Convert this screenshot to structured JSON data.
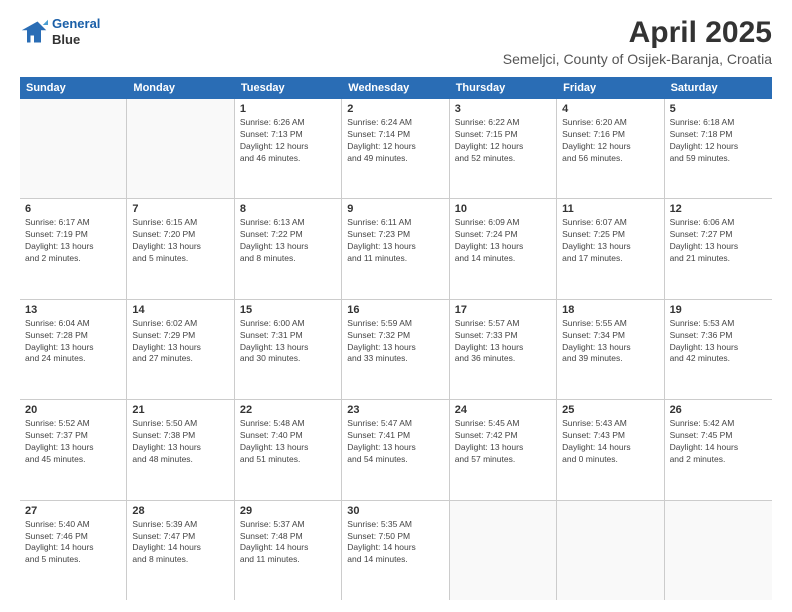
{
  "header": {
    "logo_line1": "General",
    "logo_line2": "Blue",
    "month": "April 2025",
    "location": "Semeljci, County of Osijek-Baranja, Croatia"
  },
  "weekdays": [
    "Sunday",
    "Monday",
    "Tuesday",
    "Wednesday",
    "Thursday",
    "Friday",
    "Saturday"
  ],
  "rows": [
    [
      {
        "day": "",
        "info": ""
      },
      {
        "day": "",
        "info": ""
      },
      {
        "day": "1",
        "info": "Sunrise: 6:26 AM\nSunset: 7:13 PM\nDaylight: 12 hours\nand 46 minutes."
      },
      {
        "day": "2",
        "info": "Sunrise: 6:24 AM\nSunset: 7:14 PM\nDaylight: 12 hours\nand 49 minutes."
      },
      {
        "day": "3",
        "info": "Sunrise: 6:22 AM\nSunset: 7:15 PM\nDaylight: 12 hours\nand 52 minutes."
      },
      {
        "day": "4",
        "info": "Sunrise: 6:20 AM\nSunset: 7:16 PM\nDaylight: 12 hours\nand 56 minutes."
      },
      {
        "day": "5",
        "info": "Sunrise: 6:18 AM\nSunset: 7:18 PM\nDaylight: 12 hours\nand 59 minutes."
      }
    ],
    [
      {
        "day": "6",
        "info": "Sunrise: 6:17 AM\nSunset: 7:19 PM\nDaylight: 13 hours\nand 2 minutes."
      },
      {
        "day": "7",
        "info": "Sunrise: 6:15 AM\nSunset: 7:20 PM\nDaylight: 13 hours\nand 5 minutes."
      },
      {
        "day": "8",
        "info": "Sunrise: 6:13 AM\nSunset: 7:22 PM\nDaylight: 13 hours\nand 8 minutes."
      },
      {
        "day": "9",
        "info": "Sunrise: 6:11 AM\nSunset: 7:23 PM\nDaylight: 13 hours\nand 11 minutes."
      },
      {
        "day": "10",
        "info": "Sunrise: 6:09 AM\nSunset: 7:24 PM\nDaylight: 13 hours\nand 14 minutes."
      },
      {
        "day": "11",
        "info": "Sunrise: 6:07 AM\nSunset: 7:25 PM\nDaylight: 13 hours\nand 17 minutes."
      },
      {
        "day": "12",
        "info": "Sunrise: 6:06 AM\nSunset: 7:27 PM\nDaylight: 13 hours\nand 21 minutes."
      }
    ],
    [
      {
        "day": "13",
        "info": "Sunrise: 6:04 AM\nSunset: 7:28 PM\nDaylight: 13 hours\nand 24 minutes."
      },
      {
        "day": "14",
        "info": "Sunrise: 6:02 AM\nSunset: 7:29 PM\nDaylight: 13 hours\nand 27 minutes."
      },
      {
        "day": "15",
        "info": "Sunrise: 6:00 AM\nSunset: 7:31 PM\nDaylight: 13 hours\nand 30 minutes."
      },
      {
        "day": "16",
        "info": "Sunrise: 5:59 AM\nSunset: 7:32 PM\nDaylight: 13 hours\nand 33 minutes."
      },
      {
        "day": "17",
        "info": "Sunrise: 5:57 AM\nSunset: 7:33 PM\nDaylight: 13 hours\nand 36 minutes."
      },
      {
        "day": "18",
        "info": "Sunrise: 5:55 AM\nSunset: 7:34 PM\nDaylight: 13 hours\nand 39 minutes."
      },
      {
        "day": "19",
        "info": "Sunrise: 5:53 AM\nSunset: 7:36 PM\nDaylight: 13 hours\nand 42 minutes."
      }
    ],
    [
      {
        "day": "20",
        "info": "Sunrise: 5:52 AM\nSunset: 7:37 PM\nDaylight: 13 hours\nand 45 minutes."
      },
      {
        "day": "21",
        "info": "Sunrise: 5:50 AM\nSunset: 7:38 PM\nDaylight: 13 hours\nand 48 minutes."
      },
      {
        "day": "22",
        "info": "Sunrise: 5:48 AM\nSunset: 7:40 PM\nDaylight: 13 hours\nand 51 minutes."
      },
      {
        "day": "23",
        "info": "Sunrise: 5:47 AM\nSunset: 7:41 PM\nDaylight: 13 hours\nand 54 minutes."
      },
      {
        "day": "24",
        "info": "Sunrise: 5:45 AM\nSunset: 7:42 PM\nDaylight: 13 hours\nand 57 minutes."
      },
      {
        "day": "25",
        "info": "Sunrise: 5:43 AM\nSunset: 7:43 PM\nDaylight: 14 hours\nand 0 minutes."
      },
      {
        "day": "26",
        "info": "Sunrise: 5:42 AM\nSunset: 7:45 PM\nDaylight: 14 hours\nand 2 minutes."
      }
    ],
    [
      {
        "day": "27",
        "info": "Sunrise: 5:40 AM\nSunset: 7:46 PM\nDaylight: 14 hours\nand 5 minutes."
      },
      {
        "day": "28",
        "info": "Sunrise: 5:39 AM\nSunset: 7:47 PM\nDaylight: 14 hours\nand 8 minutes."
      },
      {
        "day": "29",
        "info": "Sunrise: 5:37 AM\nSunset: 7:48 PM\nDaylight: 14 hours\nand 11 minutes."
      },
      {
        "day": "30",
        "info": "Sunrise: 5:35 AM\nSunset: 7:50 PM\nDaylight: 14 hours\nand 14 minutes."
      },
      {
        "day": "",
        "info": ""
      },
      {
        "day": "",
        "info": ""
      },
      {
        "day": "",
        "info": ""
      }
    ]
  ]
}
